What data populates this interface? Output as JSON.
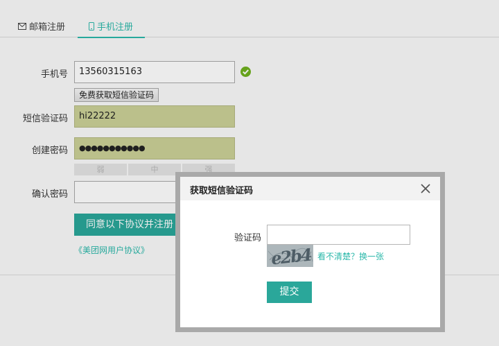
{
  "tabs": [
    {
      "label": "邮箱注册",
      "icon": "envelope-icon"
    },
    {
      "label": "手机注册",
      "icon": "mobile-phone-icon",
      "active": true
    }
  ],
  "form": {
    "phone": {
      "label": "手机号",
      "value": "13560315163",
      "valid": true
    },
    "sms_button": "免费获取短信验证码",
    "sms_code": {
      "label": "短信验证码",
      "value": "hi22222"
    },
    "password": {
      "label": "创建密码",
      "value": "●●●●●●●●●●●"
    },
    "strength": [
      "弱",
      "中",
      "强"
    ],
    "confirm": {
      "label": "确认密码",
      "value": ""
    },
    "submit": "同意以下协议并注册",
    "agreement": "《美团网用户协议》"
  },
  "dialog": {
    "title": "获取短信验证码",
    "captcha_label": "验证码",
    "captcha_value": "",
    "captcha_text": "e2b4",
    "refresh_text": "看不清楚？换一张",
    "submit": "提交"
  },
  "colors": {
    "accent": "#2aa79a",
    "filled_field": "#cbd197",
    "success": "#6fb01e"
  }
}
